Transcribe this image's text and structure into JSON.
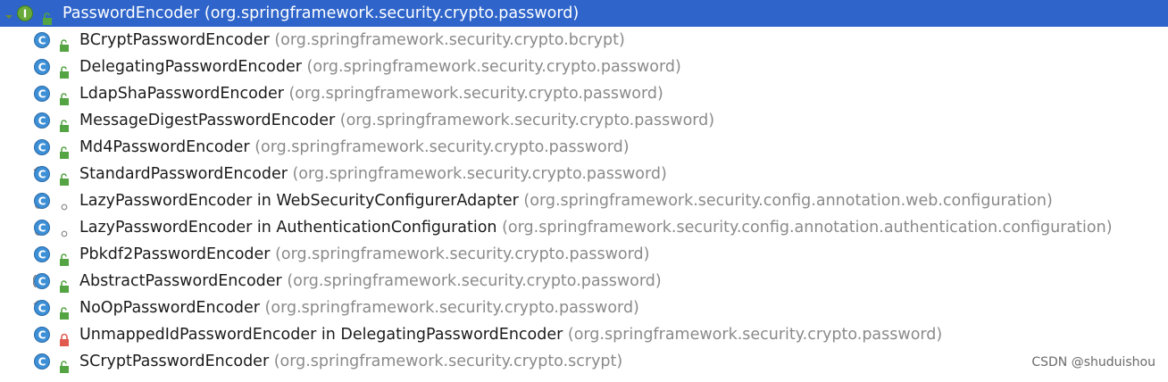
{
  "root": {
    "name": "PasswordEncoder",
    "package": "(org.springframework.security.crypto.password)",
    "icon": "interface-icon",
    "access": "public-icon"
  },
  "items": [
    {
      "name": "BCryptPasswordEncoder",
      "package": "(org.springframework.security.crypto.bcrypt)",
      "icon": "class-icon",
      "access": "public-icon"
    },
    {
      "name": "DelegatingPasswordEncoder",
      "package": "(org.springframework.security.crypto.password)",
      "icon": "class-icon",
      "access": "public-icon"
    },
    {
      "name": "LdapShaPasswordEncoder",
      "package": "(org.springframework.security.crypto.password)",
      "icon": "class-icon",
      "access": "public-icon"
    },
    {
      "name": "MessageDigestPasswordEncoder",
      "package": "(org.springframework.security.crypto.password)",
      "icon": "class-icon",
      "access": "public-icon"
    },
    {
      "name": "Md4PasswordEncoder",
      "package": "(org.springframework.security.crypto.password)",
      "icon": "class-icon",
      "access": "public-icon"
    },
    {
      "name": "StandardPasswordEncoder",
      "package": "(org.springframework.security.crypto.password)",
      "icon": "deprecated-class-icon",
      "access": "public-icon"
    },
    {
      "name": "LazyPasswordEncoder in WebSecurityConfigurerAdapter",
      "package": "(org.springframework.security.config.annotation.web.configuration)",
      "icon": "inner-class-icon",
      "access": "package-private-icon"
    },
    {
      "name": "LazyPasswordEncoder in AuthenticationConfiguration",
      "package": "(org.springframework.security.config.annotation.authentication.configuration)",
      "icon": "inner-class-icon",
      "access": "package-private-icon"
    },
    {
      "name": "Pbkdf2PasswordEncoder",
      "package": "(org.springframework.security.crypto.password)",
      "icon": "class-icon",
      "access": "public-icon"
    },
    {
      "name": "AbstractPasswordEncoder",
      "package": "(org.springframework.security.crypto.password)",
      "icon": "abstract-class-icon",
      "access": "public-icon"
    },
    {
      "name": "NoOpPasswordEncoder",
      "package": "(org.springframework.security.crypto.password)",
      "icon": "deprecated-class-icon",
      "access": "public-icon"
    },
    {
      "name": "UnmappedIdPasswordEncoder in DelegatingPasswordEncoder",
      "package": "(org.springframework.security.crypto.password)",
      "icon": "class-icon",
      "access": "private-icon"
    },
    {
      "name": "SCryptPasswordEncoder",
      "package": "(org.springframework.security.crypto.scrypt)",
      "icon": "class-icon",
      "access": "public-icon"
    }
  ],
  "watermark": "CSDN @shuduishou",
  "colors": {
    "selection": "#2f65ca",
    "class_icon": "#3d8fd6",
    "interface_icon": "#6aaa3a",
    "public_access": "#54a443",
    "private_access": "#e05a4f",
    "package_text": "#8a8a8a"
  }
}
